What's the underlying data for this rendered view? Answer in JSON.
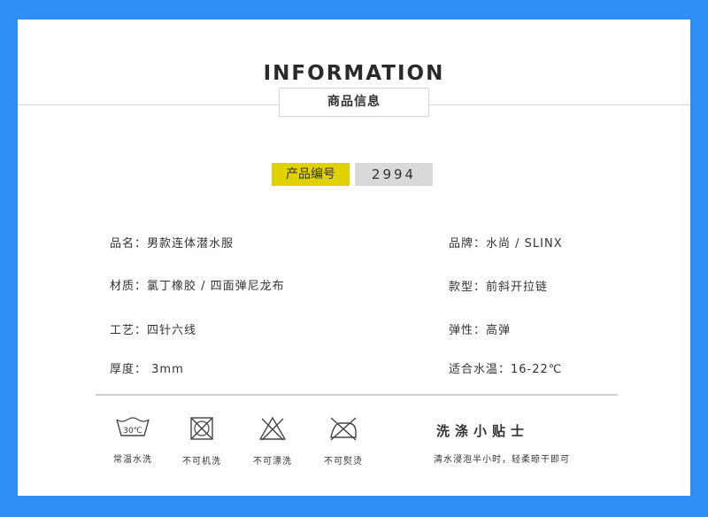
{
  "header": {
    "title": "INFORMATION",
    "subtitle": "商品信息"
  },
  "product_code": {
    "label": "产品编号",
    "value": "2994"
  },
  "details": {
    "name": "品名：男款连体潜水服",
    "brand": "品牌：水尚 / SLINX",
    "material": "材质：氯丁橡胶 / 四面弹尼龙布",
    "style": "款型：前斜开拉链",
    "craft": "工艺：四针六线",
    "elasticity": "弹性：高弹",
    "thickness": "厚度： 3mm",
    "water_temp": "适合水温：16-22℃"
  },
  "care": {
    "items": [
      {
        "icon": "wash-30-icon",
        "label": "常温水洗",
        "temp": "30℃"
      },
      {
        "icon": "no-machine-wash-icon",
        "label": "不可机洗"
      },
      {
        "icon": "no-bleach-icon",
        "label": "不可漂洗"
      },
      {
        "icon": "no-iron-icon",
        "label": "不可熨烫"
      }
    ],
    "tips_title": "洗涤小贴士",
    "tips_text": "清水浸泡半小时，轻柔晾干即可"
  },
  "colors": {
    "background": "#2e8ef5",
    "code_label_bg": "#dfd200",
    "code_value_bg": "#d9d9d9"
  }
}
